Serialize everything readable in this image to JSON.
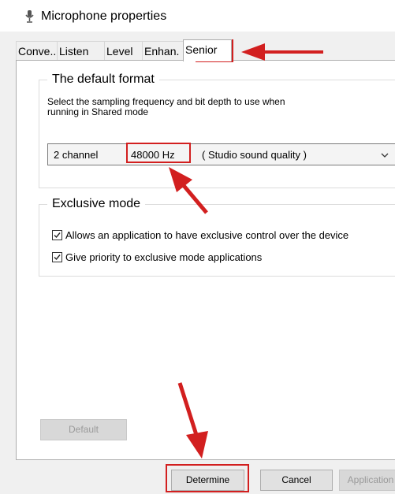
{
  "window": {
    "title": "Microphone properties"
  },
  "tabs": [
    {
      "label": "Conve.."
    },
    {
      "label": "Listen"
    },
    {
      "label": "Level"
    },
    {
      "label": "Enhan."
    },
    {
      "label": "Senior"
    }
  ],
  "default_format": {
    "title": "The default format",
    "description_line1": "Select the sampling frequency and bit depth to use when",
    "description_line2": "running in Shared mode",
    "select": {
      "channel": "2 channel",
      "frequency": "48000 Hz",
      "quality": "( Studio sound quality )"
    }
  },
  "exclusive_mode": {
    "title": "Exclusive mode",
    "options": [
      {
        "label": "Allows an application to have exclusive control over the device",
        "checked": true
      },
      {
        "label": "Give priority to exclusive mode applications",
        "checked": true
      }
    ]
  },
  "buttons": {
    "default": "Default",
    "determine": "Determine",
    "cancel": "Cancel",
    "application": "Application"
  },
  "colors": {
    "annotation": "#d21f1f",
    "panel": "#ffffff",
    "window": "#f0f0f0"
  }
}
